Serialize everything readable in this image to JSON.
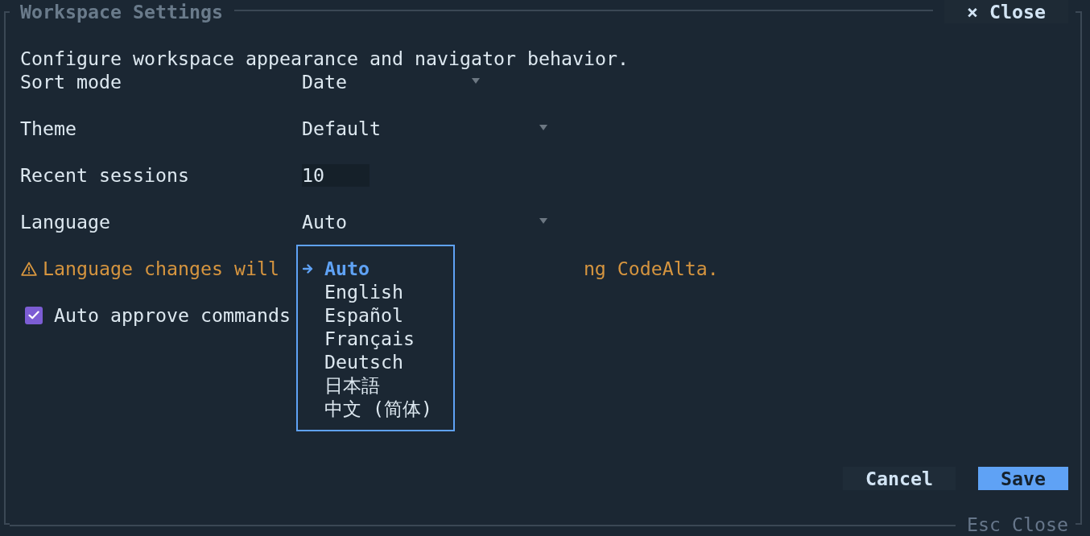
{
  "window": {
    "title": "Workspace Settings",
    "close_button": "× Close",
    "shortcut_hint": "Esc Close"
  },
  "description": "Configure workspace appearance and navigator behavior.",
  "settings": [
    {
      "kind": "select",
      "label": "Sort mode",
      "value": "Date"
    },
    {
      "kind": "select",
      "label": "Theme",
      "value": "Default"
    },
    {
      "kind": "number",
      "label": "Recent sessions",
      "value": "10"
    },
    {
      "kind": "select",
      "label": "Language",
      "value": "Auto"
    }
  ],
  "warning": {
    "text_start": "Language changes will",
    "text_end": "ng CodeAlta."
  },
  "checkbox": {
    "label": "Auto approve commands",
    "checked": true
  },
  "language_menu": {
    "options": [
      {
        "label": "Auto",
        "selected": true
      },
      {
        "label": "English",
        "selected": false
      },
      {
        "label": "Español",
        "selected": false
      },
      {
        "label": "Français",
        "selected": false
      },
      {
        "label": "Deutsch",
        "selected": false
      },
      {
        "label": "日本語",
        "selected": false
      },
      {
        "label": "中文 (简体)",
        "selected": false
      }
    ]
  },
  "buttons": [
    {
      "kind": "secondary",
      "label": "Cancel"
    },
    {
      "kind": "primary",
      "label": "Save"
    }
  ]
}
